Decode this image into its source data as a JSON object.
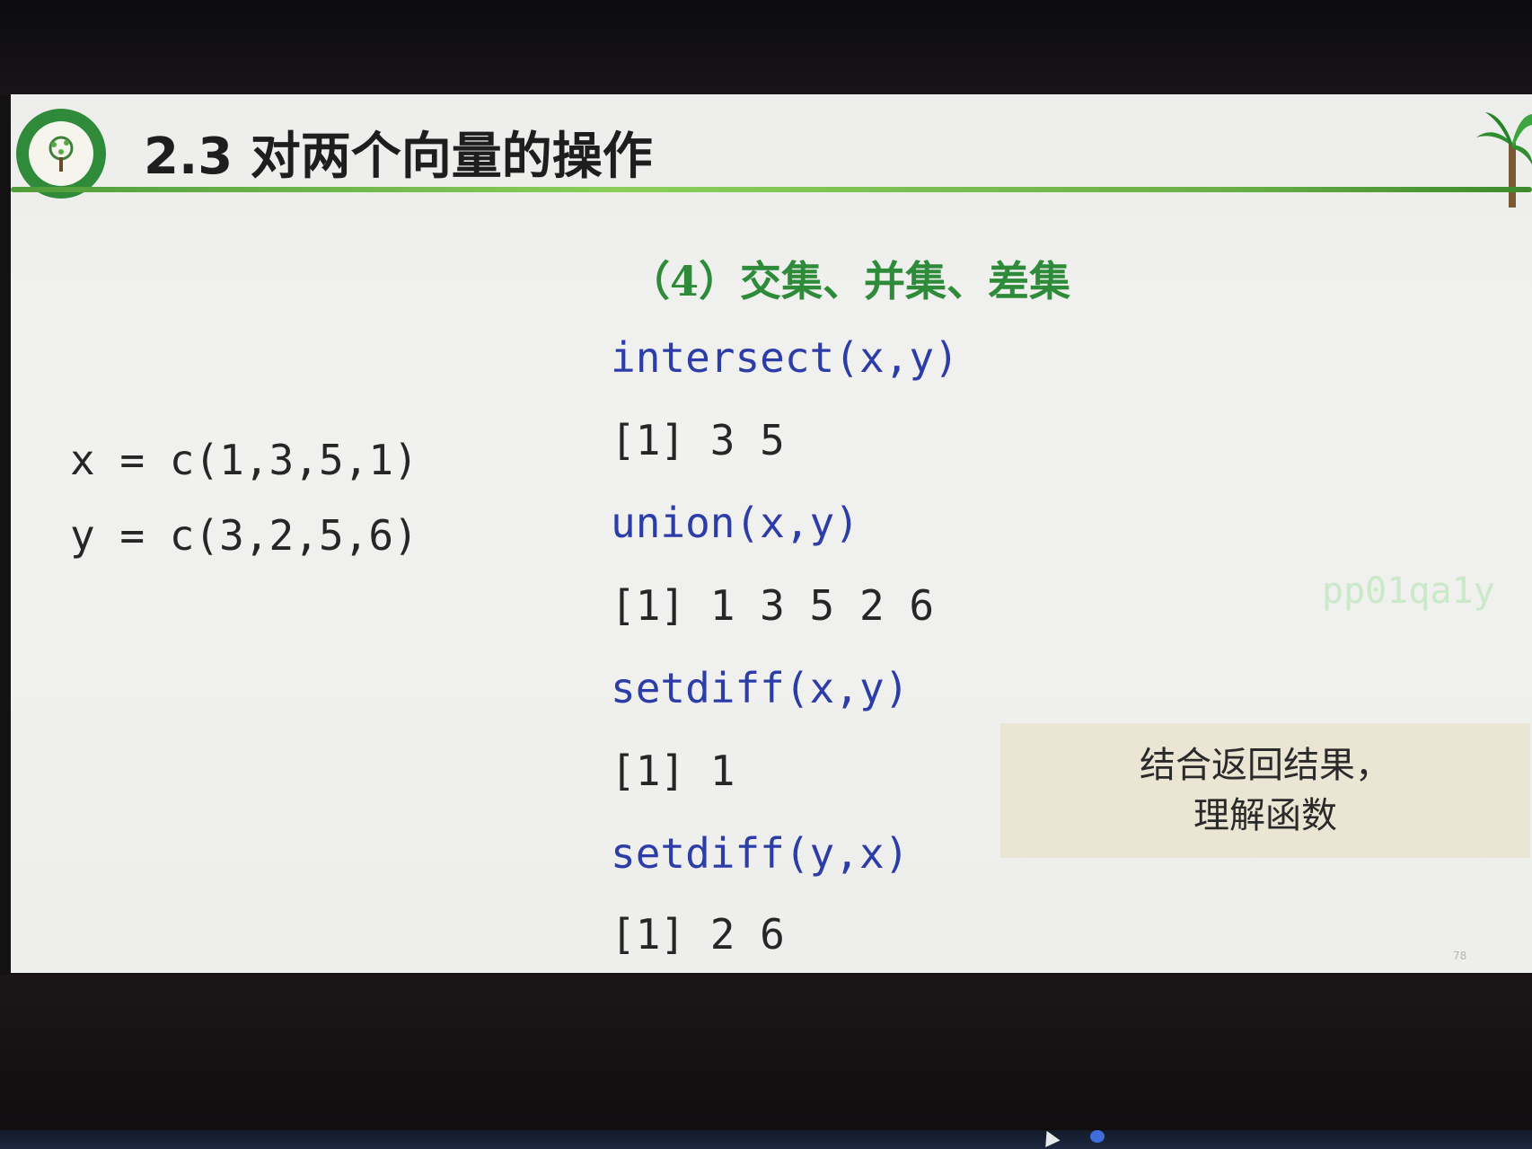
{
  "slide": {
    "title": "2.3 对两个向量的操作",
    "section_heading": "（4）交集、并集、差集",
    "definitions": [
      "x = c(1,3,5,1)",
      "y = c(3,2,5,6)"
    ],
    "code_blocks": [
      {
        "call": "intersect(x,y)",
        "output": "[1] 3 5"
      },
      {
        "call": "union(x,y)",
        "output": "[1] 1 3 5 2 6"
      },
      {
        "call": "setdiff(x,y)",
        "output": "[1] 1"
      },
      {
        "call": "setdiff(y,x)",
        "output": "[1] 2 6"
      }
    ],
    "watermark": "pp01qa1y",
    "note": {
      "line1": "结合返回结果，",
      "line2": "理解函数"
    },
    "page_number": "78"
  },
  "colors": {
    "title_text": "#1e1e1e",
    "heading_green": "#2e8b3a",
    "code_call_blue": "#2c3da8",
    "code_output": "#262626",
    "note_background": "#ebe5d4",
    "header_line_green": "#68b046"
  },
  "icons": {
    "logo": "university-emblem-icon",
    "decoration": "palm-tree-icon"
  }
}
